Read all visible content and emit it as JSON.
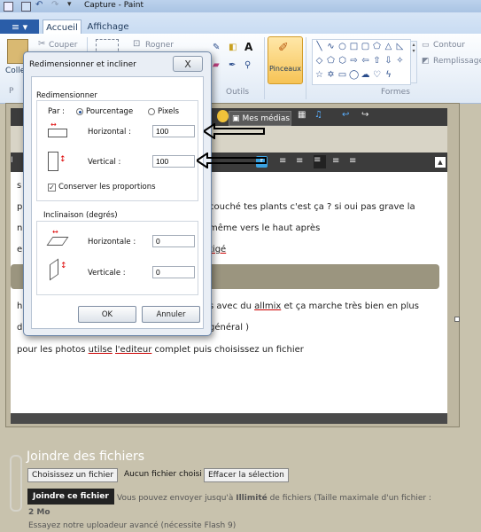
{
  "app": {
    "title": "Capture - Paint"
  },
  "ribbon": {
    "file_label": "≡ ▾",
    "tabs": [
      "Accueil",
      "Affichage"
    ],
    "clipboard": {
      "coller": "Coller",
      "couper": "Couper",
      "label_short": "Colle",
      "group_short": "P"
    },
    "image": {
      "rogner": "Rogner"
    },
    "outils_label": "Outils",
    "pinceaux_label": "Pinceaux",
    "contour_label": "Contour",
    "remplissage_label": "Remplissage",
    "formes_label": "Formes"
  },
  "editor": {
    "medias_label": "Mes médias",
    "toolbar_letter": "I",
    "lines": {
      "l1_start": "s",
      "l2_start": "p",
      "l2": "couché tes plants c'est ça ? si oui pas grave la",
      "l3_start": "n",
      "l3": "même vers le haut après",
      "l4_start": "e",
      "l4_link": "tigé",
      "l5_start": "h",
      "l5a": "s avec du ",
      "l5_link": "allmix",
      "l5b": " et ça marche très bien en plus",
      "l6_start": "d",
      "l6": "général )",
      "l7a": "pour les photos ",
      "l7_link1": "utilse",
      "l7b": " ",
      "l7_link2": "l'editeur",
      "l7c": " complet puis choisissez un fichier"
    }
  },
  "attachments": {
    "title": "Joindre des fichiers",
    "choose_button": "Choisissez un fichier",
    "no_file": "Aucun fichier choisi",
    "clear_button": "Effacer la sélection",
    "join_button": "Joindre ce fichier",
    "info_a": "Vous pouvez envoyer jusqu'à ",
    "info_bold": "Illimité",
    "info_b": " de fichiers (Taille maximale d'un fichier :",
    "info_size": "2 Mo",
    "uploader": "Essayez notre uploadeur avancé (nécessite Flash 9)"
  },
  "dialog": {
    "title": "Redimensionner et incliner",
    "close": "X",
    "resize": {
      "legend": "Redimensionner",
      "par_label": "Par :",
      "option_percent": "Pourcentage",
      "option_pixels": "Pixels",
      "selected": "Pourcentage",
      "horizontal_label": "Horizontal :",
      "horizontal_value": "100",
      "vertical_label": "Vertical :",
      "vertical_value": "100",
      "keep_ratio_label": "Conserver les proportions",
      "keep_ratio_checked": true
    },
    "skew": {
      "legend": "Inclinaison (degrés)",
      "horizontal_label": "Horizontale :",
      "horizontal_value": "0",
      "vertical_label": "Verticale :",
      "vertical_value": "0"
    },
    "ok": "OK",
    "cancel": "Annuler"
  },
  "colors": {
    "paint_accent": "#2a5da8",
    "forum_bg": "#c8c2ad",
    "arrow": "#000000"
  }
}
